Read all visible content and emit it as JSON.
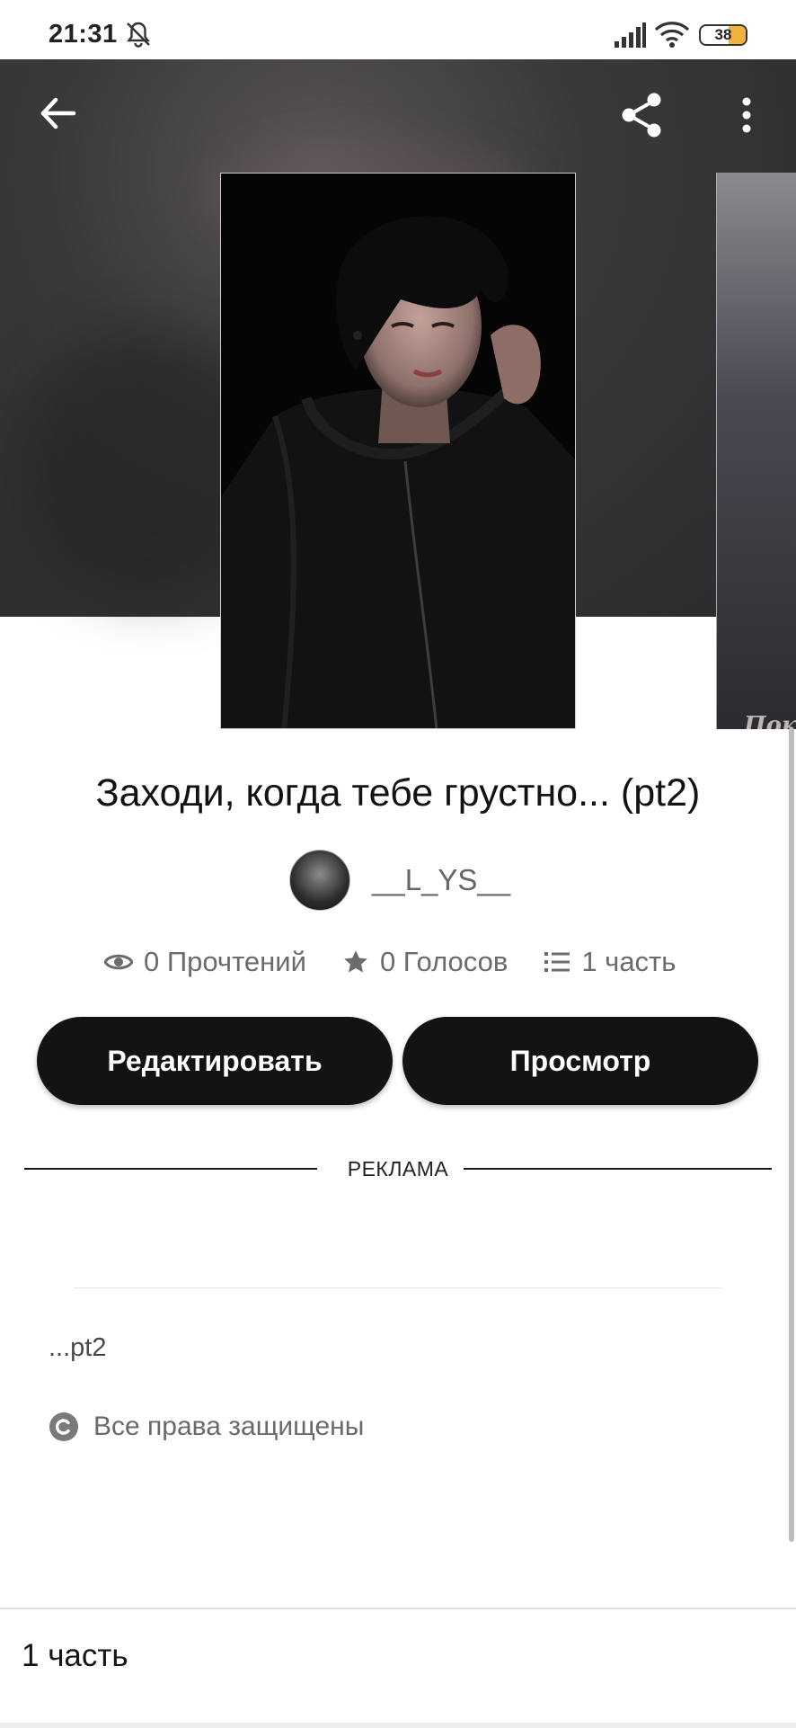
{
  "status_bar": {
    "time": "21:31",
    "battery_level": "38",
    "battery_fill": 0.38,
    "icons": [
      "bell-off-icon",
      "signal-icon",
      "wifi-icon",
      "battery-icon"
    ]
  },
  "toolbar": {
    "back_icon": "arrow-left-icon",
    "share_icon": "share-icon",
    "more_icon": "more-vertical-icon"
  },
  "story": {
    "title": "Заходи, когда тебе грустно... (pt2)",
    "author": "__L_YS__",
    "stats": {
      "reads": "0 Прочтений",
      "votes": "0 Голосов",
      "parts": "1 часть"
    },
    "description": "...pt2",
    "rights": "Все права защищены",
    "next_cover_text": "Пок"
  },
  "buttons": {
    "edit": "Редактировать",
    "view": "Просмотр"
  },
  "ad": {
    "label": "РЕКЛАМА"
  },
  "bottom_bar": {
    "label": "1 часть"
  },
  "colors": {
    "button_bg": "#141214",
    "header_bg": "#2b2a2c",
    "battery_accent": "#f2b33d"
  }
}
